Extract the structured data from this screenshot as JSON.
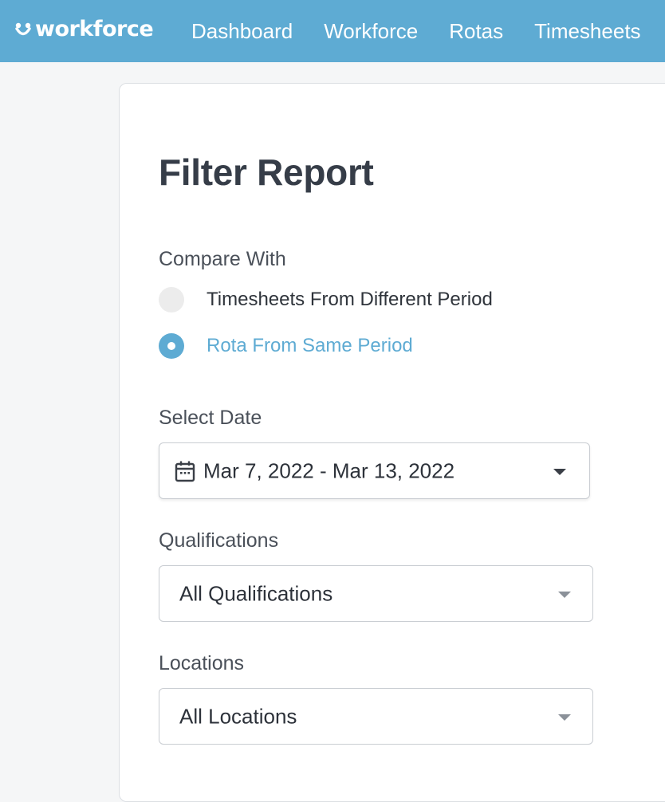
{
  "brand": {
    "name": "workforce"
  },
  "nav": {
    "items": [
      "Dashboard",
      "Workforce",
      "Rotas",
      "Timesheets"
    ]
  },
  "page": {
    "title": "Filter Report"
  },
  "compare": {
    "label": "Compare With",
    "options": [
      {
        "label": "Timesheets From Different Period",
        "selected": false
      },
      {
        "label": "Rota From Same Period",
        "selected": true
      }
    ]
  },
  "date": {
    "label": "Select Date",
    "value": "Mar 7, 2022 - Mar 13, 2022"
  },
  "qualifications": {
    "label": "Qualifications",
    "value": "All Qualifications"
  },
  "locations": {
    "label": "Locations",
    "value": "All Locations"
  },
  "colors": {
    "brand": "#5eabd3",
    "text": "#363d48"
  }
}
